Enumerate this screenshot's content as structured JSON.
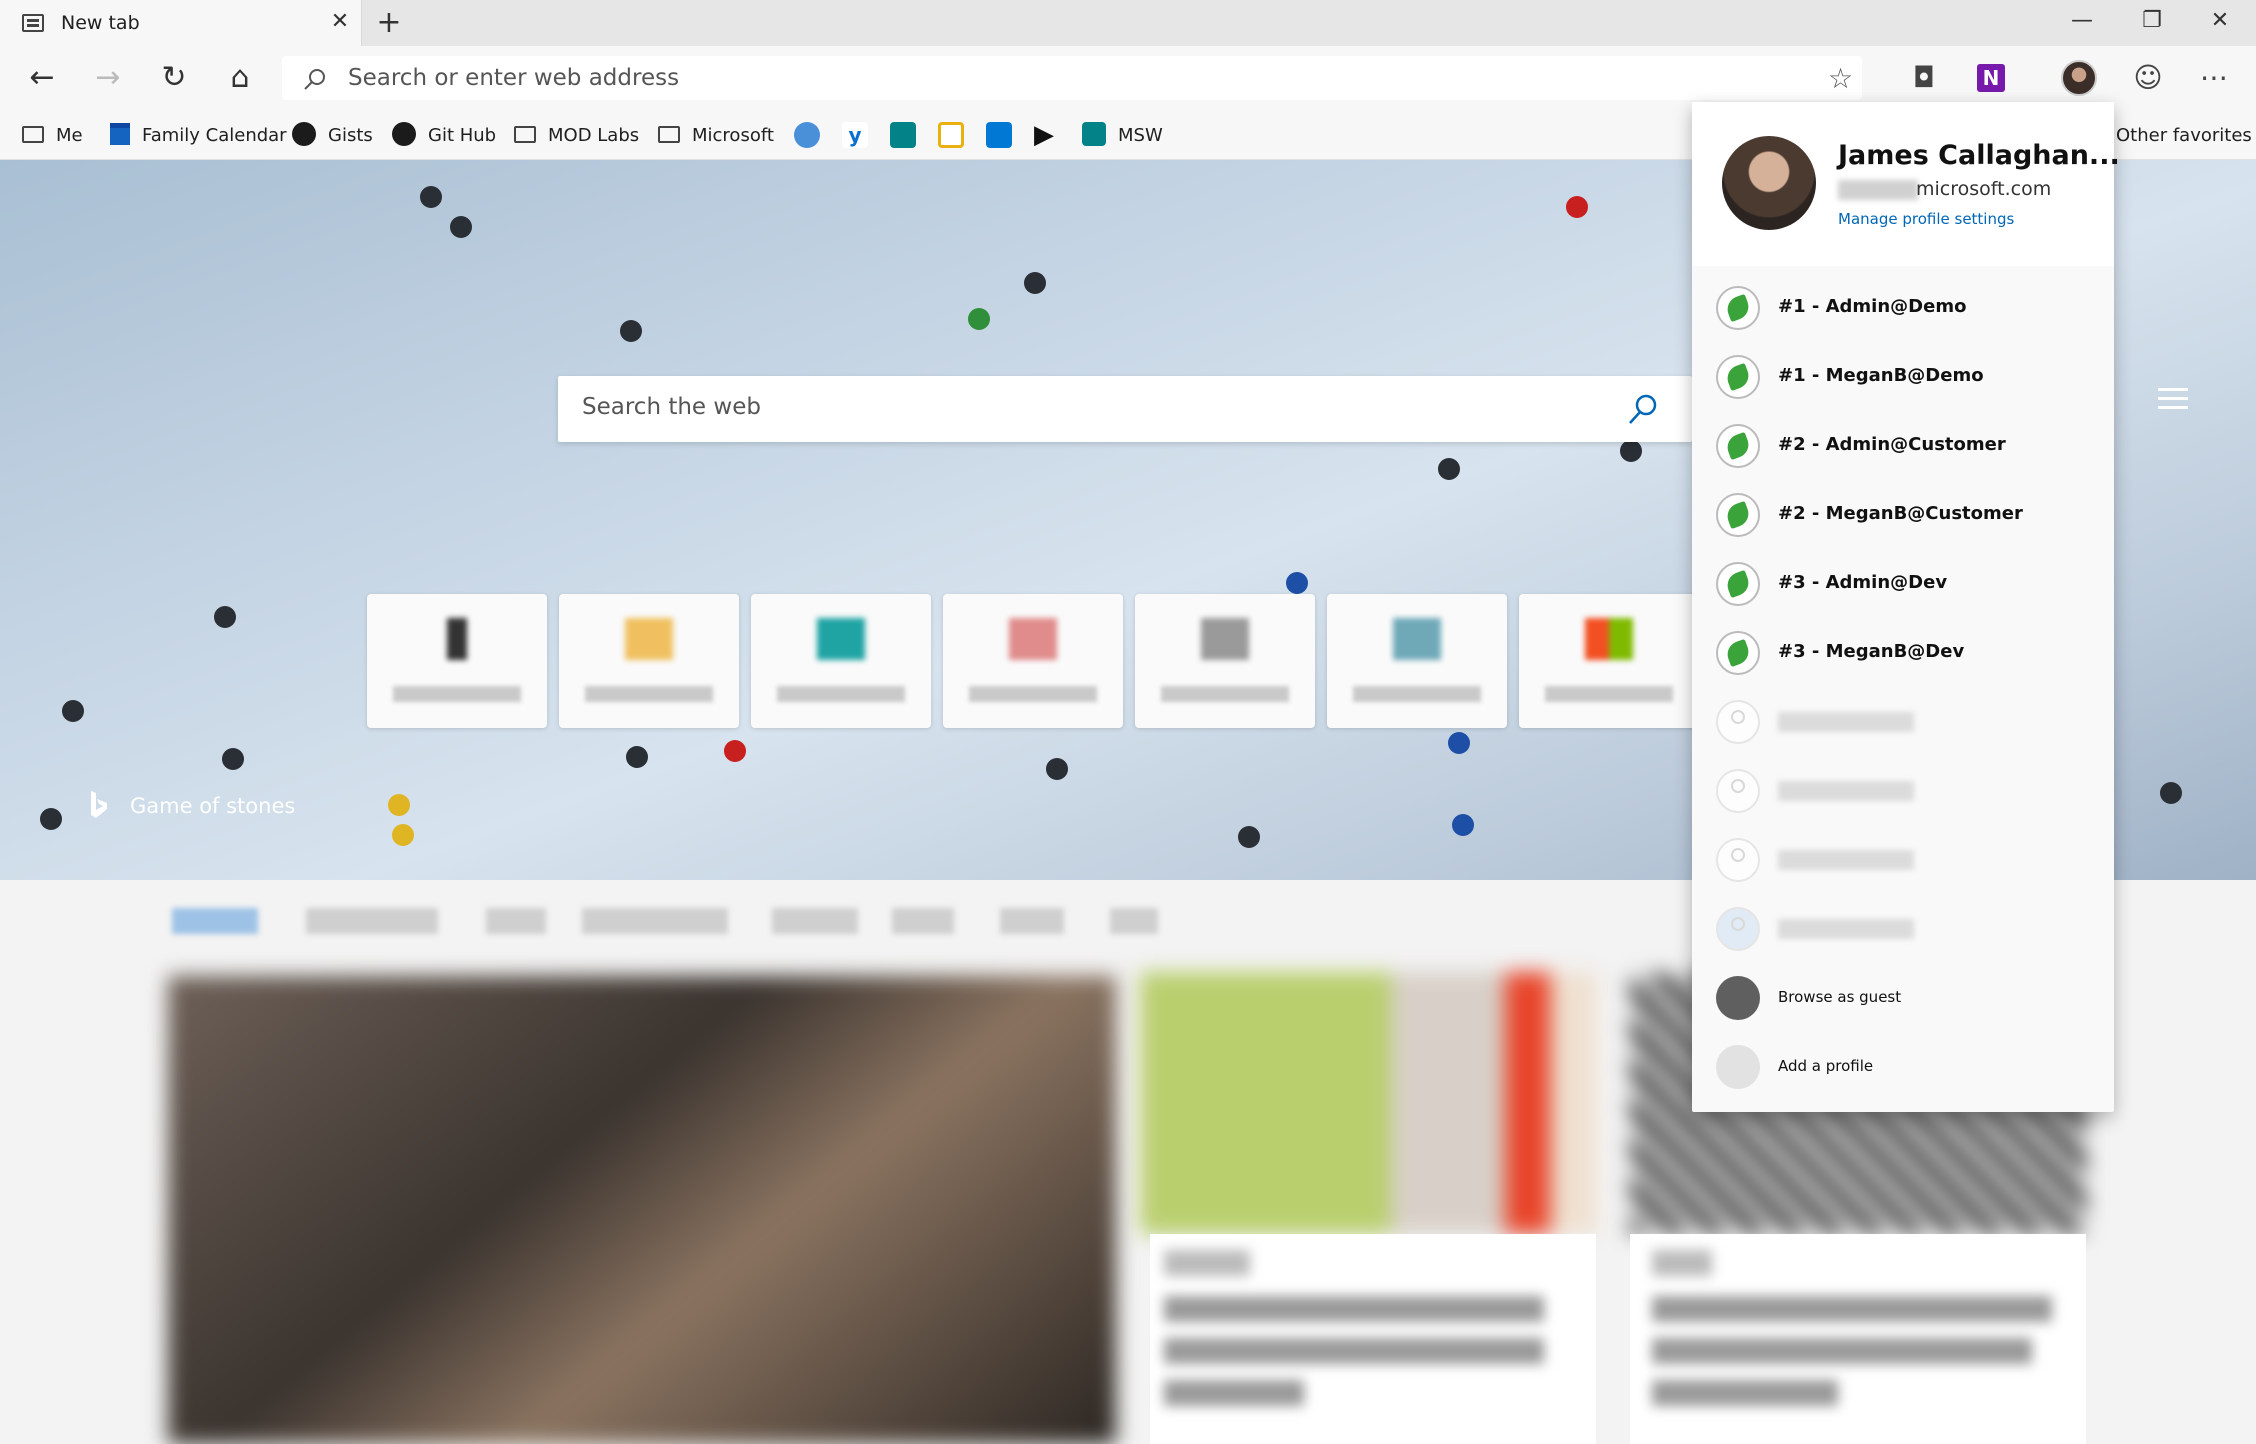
{
  "tab": {
    "title": "New tab"
  },
  "window": {
    "minimize": "—",
    "restore": "❐",
    "close": "✕"
  },
  "omnibox": {
    "placeholder": "Search or enter web address"
  },
  "favorites": [
    {
      "label": "Me",
      "icon": "folder-icon"
    },
    {
      "label": "Family Calendar",
      "icon": "calendar-icon"
    },
    {
      "label": "Gists",
      "icon": "github-icon"
    },
    {
      "label": "Git Hub",
      "icon": "github-icon"
    },
    {
      "label": "MOD Labs",
      "icon": "folder-icon"
    },
    {
      "label": "Microsoft",
      "icon": "folder-icon"
    },
    {
      "label": "MSW",
      "icon": "sharepoint-icon"
    }
  ],
  "other_favorites": "Other favorites",
  "hero": {
    "search_placeholder": "Search the web",
    "caption": "Game of stones"
  },
  "profile": {
    "name": "James Callaghan...",
    "email_domain": "microsoft.com",
    "manage": "Manage profile settings",
    "profiles": [
      {
        "label": "#1 - Admin@Demo"
      },
      {
        "label": "#1 - MeganB@Demo"
      },
      {
        "label": "#2 - Admin@Customer"
      },
      {
        "label": "#2 - MeganB@Customer"
      },
      {
        "label": "#3 - Admin@Dev"
      },
      {
        "label": "#3 - MeganB@Dev"
      }
    ],
    "guest": "Browse as guest",
    "add": "Add a profile"
  },
  "colors": {
    "accent": "#0067b8",
    "onenote": "#7719aa"
  }
}
